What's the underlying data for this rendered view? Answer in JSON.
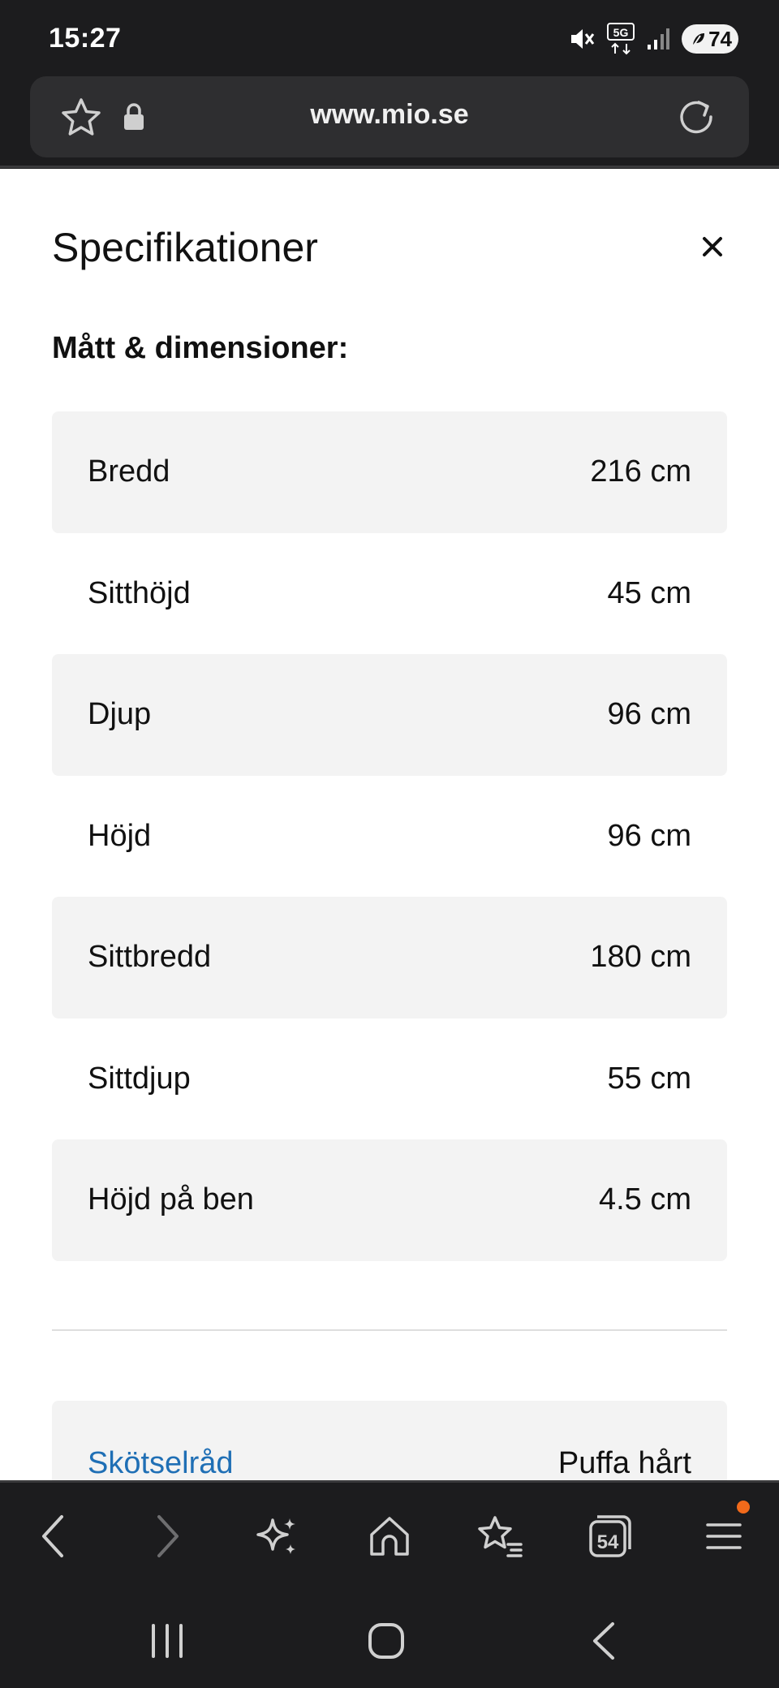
{
  "status_bar": {
    "time": "15:27",
    "network": "5G",
    "battery": "74",
    "icons": [
      "mute-icon",
      "5g-data-icon",
      "signal-icon",
      "battery-icon"
    ]
  },
  "browser": {
    "url": "www.mio.se"
  },
  "specs": {
    "title": "Specifikationer",
    "section_heading": "Mått & dimensioner:",
    "rows": [
      {
        "label": "Bredd",
        "value": "216 cm"
      },
      {
        "label": "Sitthöjd",
        "value": "45 cm"
      },
      {
        "label": "Djup",
        "value": "96 cm"
      },
      {
        "label": "Höjd",
        "value": "96 cm"
      },
      {
        "label": "Sittbredd",
        "value": "180 cm"
      },
      {
        "label": "Sittdjup",
        "value": "55 cm"
      },
      {
        "label": "Höjd på ben",
        "value": "4.5 cm"
      }
    ],
    "care": {
      "label": "Skötselråd",
      "value": "Puffa hårt"
    }
  },
  "toolbar": {
    "tabs_count": "54",
    "icons": [
      "back-icon",
      "forward-icon",
      "sparkle-icon",
      "home-icon",
      "bookmarks-icon",
      "tabs-icon",
      "menu-icon"
    ]
  },
  "colors": {
    "link": "#1f6fb5",
    "row_shade": "#f3f3f3",
    "notification": "#f26a1b"
  }
}
